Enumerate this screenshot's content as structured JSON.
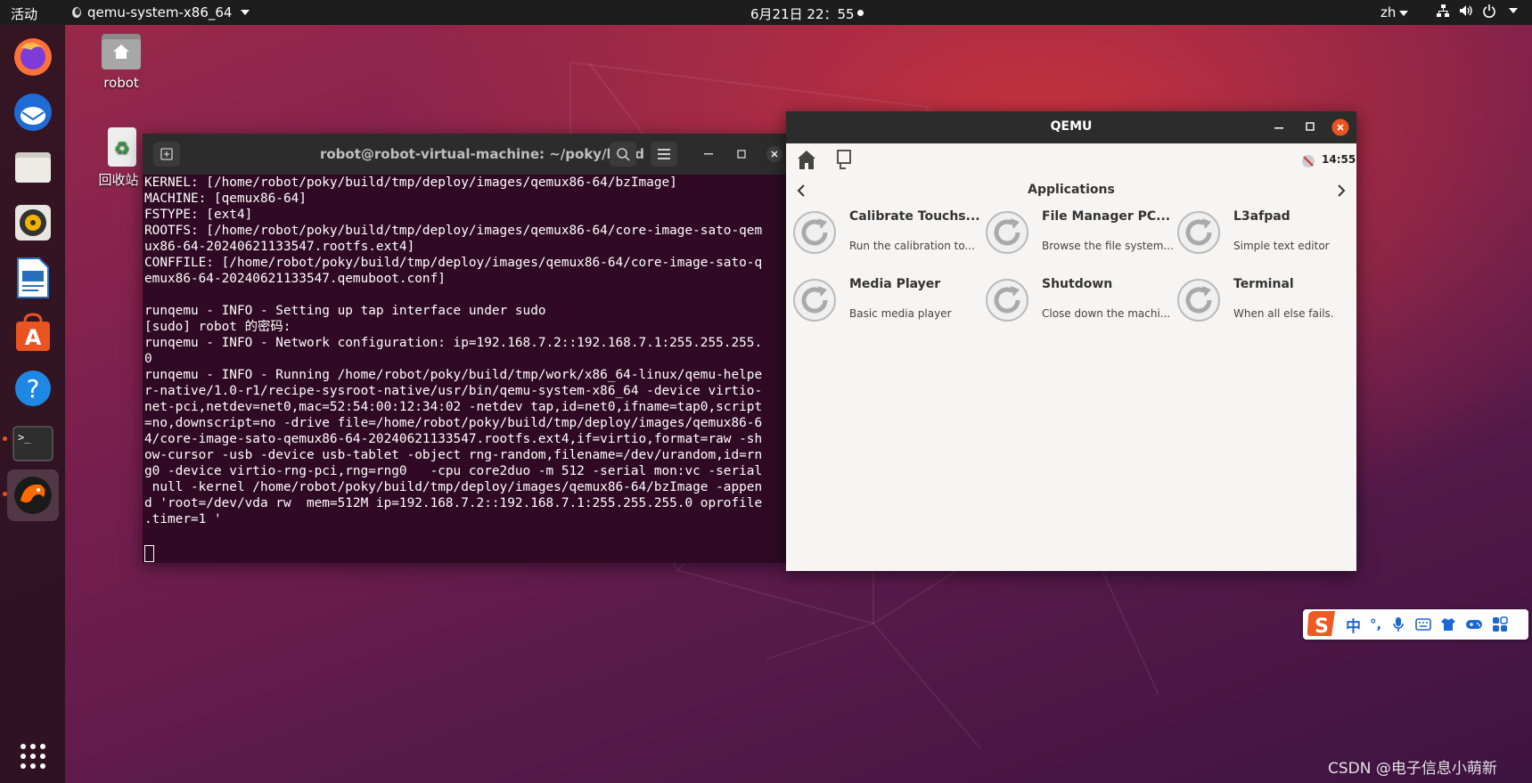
{
  "topbar": {
    "activities": "活动",
    "app_menu": "qemu-system-x86_64",
    "clock": "6月21日  22：55",
    "lang": "zh"
  },
  "desktop": {
    "home_label": "robot",
    "trash_label": "回收站"
  },
  "dock": {
    "items": [
      "firefox-icon",
      "thunderbird-icon",
      "files-icon",
      "rhythmbox-icon",
      "writer-icon",
      "software-icon",
      "help-icon",
      "terminal-icon",
      "qemu-icon"
    ]
  },
  "terminal": {
    "title": "robot@robot-virtual-machine: ~/poky/build",
    "lines": [
      "KERNEL: [/home/robot/poky/build/tmp/deploy/images/qemux86-64/bzImage]",
      "MACHINE: [qemux86-64]",
      "FSTYPE: [ext4]",
      "ROOTFS: [/home/robot/poky/build/tmp/deploy/images/qemux86-64/core-image-sato-qem",
      "ux86-64-20240621133547.rootfs.ext4]",
      "CONFFILE: [/home/robot/poky/build/tmp/deploy/images/qemux86-64/core-image-sato-q",
      "emux86-64-20240621133547.qemuboot.conf]",
      "",
      "runqemu - INFO - Setting up tap interface under sudo",
      "[sudo] robot 的密码:",
      "runqemu - INFO - Network configuration: ip=192.168.7.2::192.168.7.1:255.255.255.",
      "0",
      "runqemu - INFO - Running /home/robot/poky/build/tmp/work/x86_64-linux/qemu-helpe",
      "r-native/1.0-r1/recipe-sysroot-native/usr/bin/qemu-system-x86_64 -device virtio-",
      "net-pci,netdev=net0,mac=52:54:00:12:34:02 -netdev tap,id=net0,ifname=tap0,script",
      "=no,downscript=no -drive file=/home/robot/poky/build/tmp/deploy/images/qemux86-6",
      "4/core-image-sato-qemux86-64-20240621133547.rootfs.ext4,if=virtio,format=raw -sh",
      "ow-cursor -usb -device usb-tablet -object rng-random,filename=/dev/urandom,id=rn",
      "g0 -device virtio-rng-pci,rng=rng0   -cpu core2duo -m 512 -serial mon:vc -serial",
      " null -kernel /home/robot/poky/build/tmp/deploy/images/qemux86-64/bzImage -appen",
      "d 'root=/dev/vda rw  mem=512M ip=192.168.7.2::192.168.7.1:255.255.255.0 oprofile",
      ".timer=1 '"
    ]
  },
  "qemu": {
    "title": "QEMU",
    "time": "14:55",
    "section": "Applications",
    "apps": [
      {
        "name": "Calibrate Touchs...",
        "desc": "Run the calibration to..."
      },
      {
        "name": "File Manager PC...",
        "desc": "Browse the file system..."
      },
      {
        "name": "L3afpad",
        "desc": "Simple text editor"
      },
      {
        "name": "Media Player",
        "desc": "Basic media player"
      },
      {
        "name": "Shutdown",
        "desc": "Close down the machi..."
      },
      {
        "name": "Terminal",
        "desc": "When all else fails."
      }
    ]
  },
  "ime": {
    "mode": "中",
    "punct": "°,"
  },
  "watermark": "CSDN @电子信息小萌新",
  "colors": {
    "ubuntu_orange": "#e95420",
    "terminal_bg": "#300a24",
    "titlebar": "#2c2c2c"
  }
}
